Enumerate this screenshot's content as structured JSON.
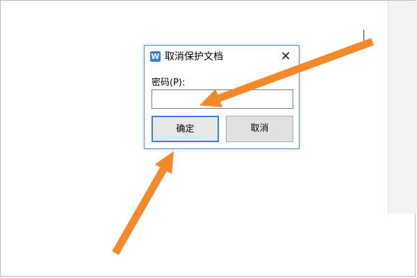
{
  "dialog": {
    "app_icon_letter": "W",
    "title": "取消保护文档",
    "close_glyph": "✕",
    "password_label": "密码(P):",
    "password_value": "",
    "ok_label": "确定",
    "cancel_label": "取消"
  },
  "colors": {
    "arrow": "#f5892a",
    "dialog_border": "#4a90d9",
    "ok_border": "#3c7fd6",
    "app_icon": "#2b7de9"
  }
}
